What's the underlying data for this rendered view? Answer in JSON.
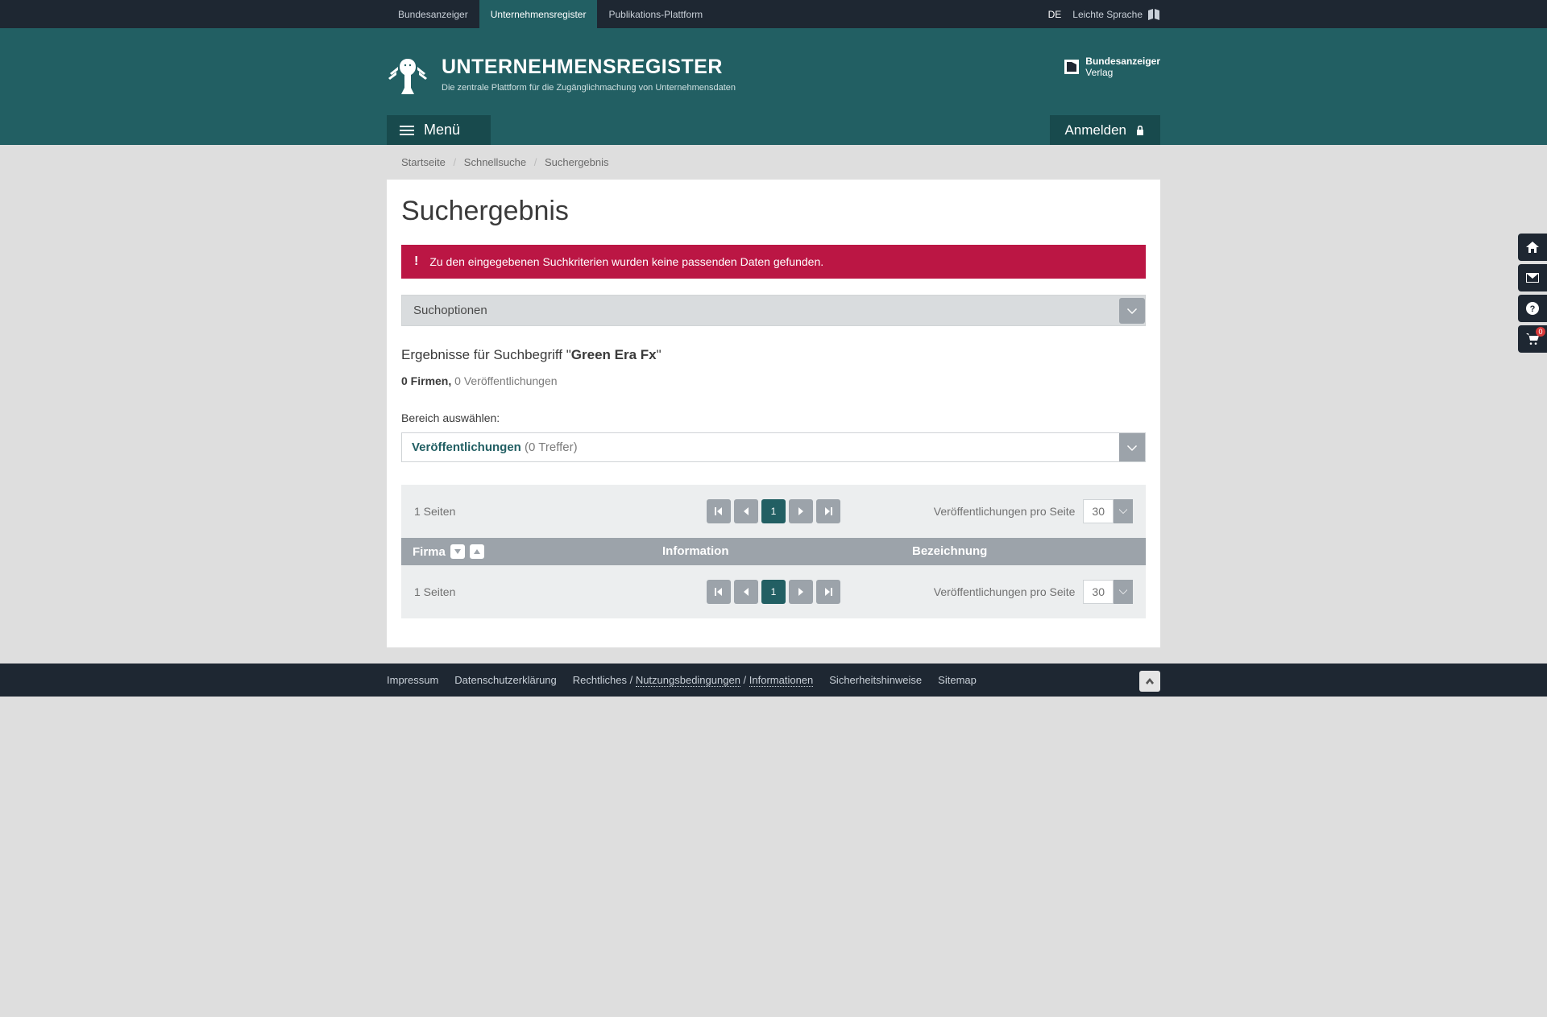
{
  "topnav": {
    "items": [
      {
        "label": "Bundesanzeiger",
        "active": false
      },
      {
        "label": "Unternehmensregister",
        "active": true
      },
      {
        "label": "Publikations-Plattform",
        "active": false
      }
    ],
    "lang": "DE",
    "easy_lang": "Leichte Sprache"
  },
  "brand": {
    "title": "UNTERNEHMENSREGISTER",
    "sub": "Die zentrale Plattform für die Zugänglichmachung von Unternehmensdaten"
  },
  "verlag": {
    "line1": "Bundesanzeiger",
    "line2": "Verlag"
  },
  "menu": {
    "menu_label": "Menü",
    "login_label": "Anmelden"
  },
  "breadcrumb": {
    "items": [
      "Startseite",
      "Schnellsuche",
      "Suchergebnis"
    ]
  },
  "page_title": "Suchergebnis",
  "alert": {
    "text": "Zu den eingegebenen Suchkriterien wurden keine passenden Daten gefunden."
  },
  "search_options_label": "Suchoptionen",
  "results": {
    "prefix": "Ergebnisse für Suchbegriff \"",
    "term": "Green Era Fx",
    "suffix": "\"",
    "firms_label": "0 Firmen,",
    "pubs_label": " 0 Veröffentlichungen"
  },
  "area": {
    "label": "Bereich auswählen:",
    "selected_main": "Veröffentlichungen",
    "selected_hits": " (0 Treffer)"
  },
  "pager": {
    "pages_label": "1 Seiten",
    "current": "1",
    "perpage_label": "Veröffentlichungen pro Seite",
    "perpage_value": "30"
  },
  "table": {
    "col1": "Firma",
    "col2": "Information",
    "col3": "Bezeichnung"
  },
  "footer": {
    "items": [
      "Impressum",
      "Datenschutzerklärung",
      "Rechtliches / ",
      "Nutzungsbedingungen",
      " / ",
      "Informationen",
      "Sicherheitshinweise",
      "Sitemap"
    ]
  },
  "rail": {
    "cart_count": "0"
  }
}
